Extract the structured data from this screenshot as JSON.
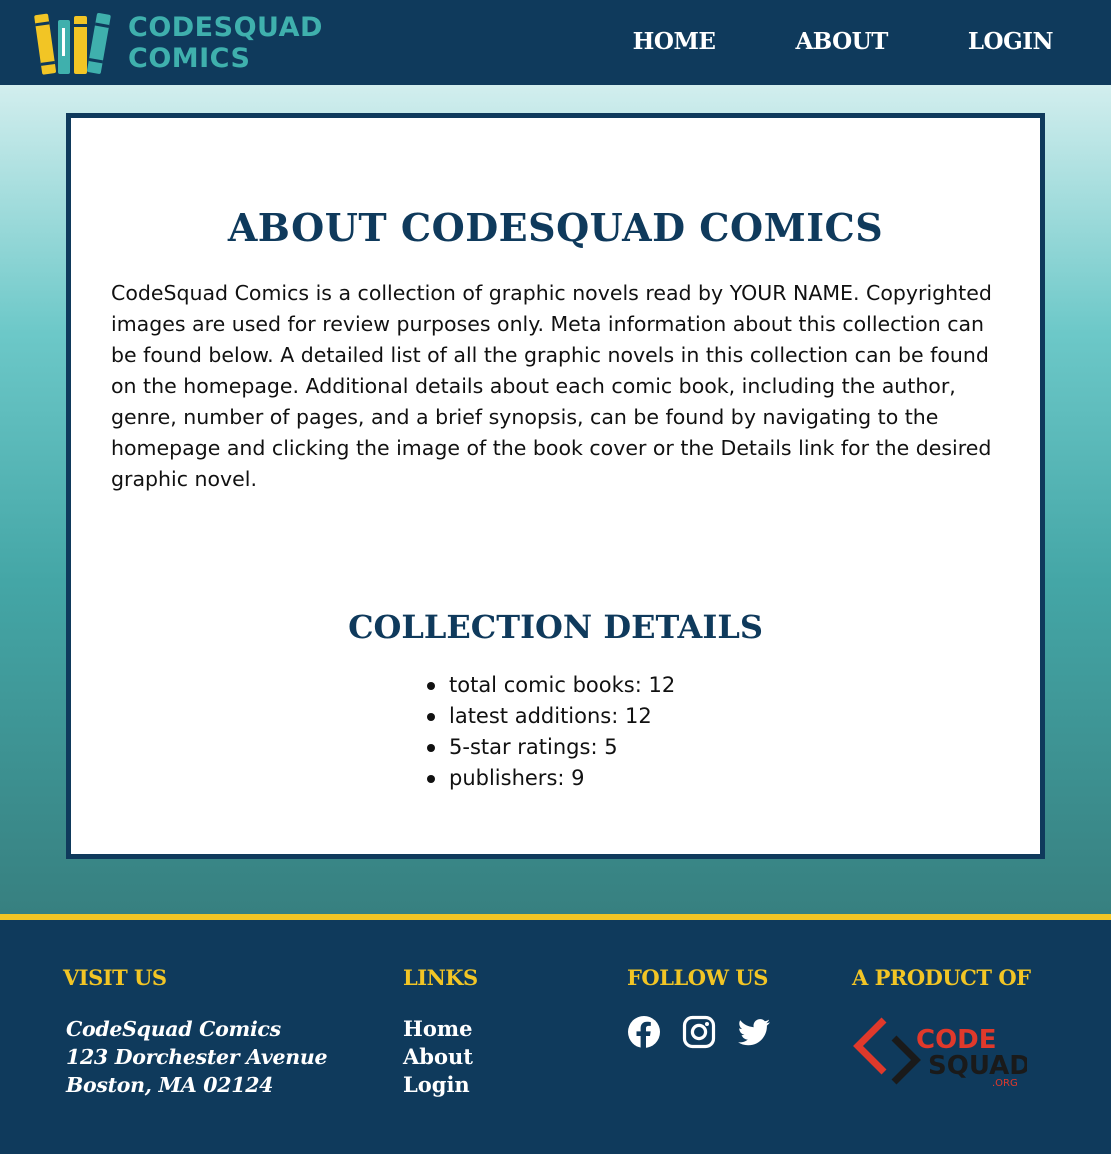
{
  "header": {
    "logo_line1": "CODESQUAD",
    "logo_line2": "COMICS",
    "nav": [
      {
        "label": "HOME"
      },
      {
        "label": "ABOUT"
      },
      {
        "label": "LOGIN"
      }
    ]
  },
  "main": {
    "about_title": "ABOUT CODESQUAD COMICS",
    "about_text": "CodeSquad Comics is a collection of graphic novels read by YOUR NAME. Copyrighted images are used for review purposes only. Meta information about this collection can be found below. A detailed list of all the graphic novels in this collection can be found on the homepage. Additional details about each comic book, including the author, genre, number of pages, and a brief synopsis, can be found by navigating to the homepage and clicking the image of the book cover or the Details link for the desired graphic novel.",
    "collection_title": "COLLECTION DETAILS",
    "details": [
      "total comic books: 12",
      "latest additions: 12",
      "5-star ratings: 5",
      "publishers: 9"
    ]
  },
  "footer": {
    "visit_heading": "VISIT US",
    "address": [
      "CodeSquad Comics",
      "123 Dorchester Avenue",
      "Boston, MA 02124"
    ],
    "links_heading": "LINKS",
    "links": [
      "Home",
      "About",
      "Login"
    ],
    "follow_heading": "FOLLOW US",
    "social_icons": [
      "facebook-icon",
      "instagram-icon",
      "twitter-icon"
    ],
    "product_heading": "A PRODUCT OF",
    "product_logo": {
      "line1": "CODE",
      "line2": "SQUAD",
      "suffix": ".ORG"
    }
  },
  "colors": {
    "navy": "#0f3a5c",
    "teal": "#3fb0ad",
    "yellow": "#f2c525",
    "logo_red": "#e0392b"
  }
}
